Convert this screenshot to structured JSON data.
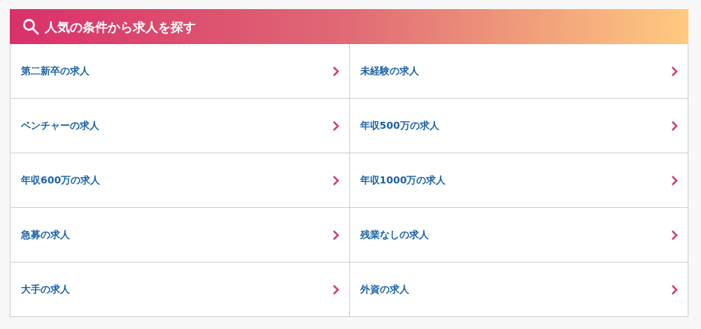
{
  "header": {
    "title": "人気の条件から求人を探す"
  },
  "links": [
    {
      "label": "第二新卒の求人"
    },
    {
      "label": "未経験の求人"
    },
    {
      "label": "ベンチャーの求人"
    },
    {
      "label": "年収500万の求人"
    },
    {
      "label": "年収600万の求人"
    },
    {
      "label": "年収1000万の求人"
    },
    {
      "label": "急募の求人"
    },
    {
      "label": "残業なしの求人"
    },
    {
      "label": "大手の求人"
    },
    {
      "label": "外資の求人"
    }
  ]
}
